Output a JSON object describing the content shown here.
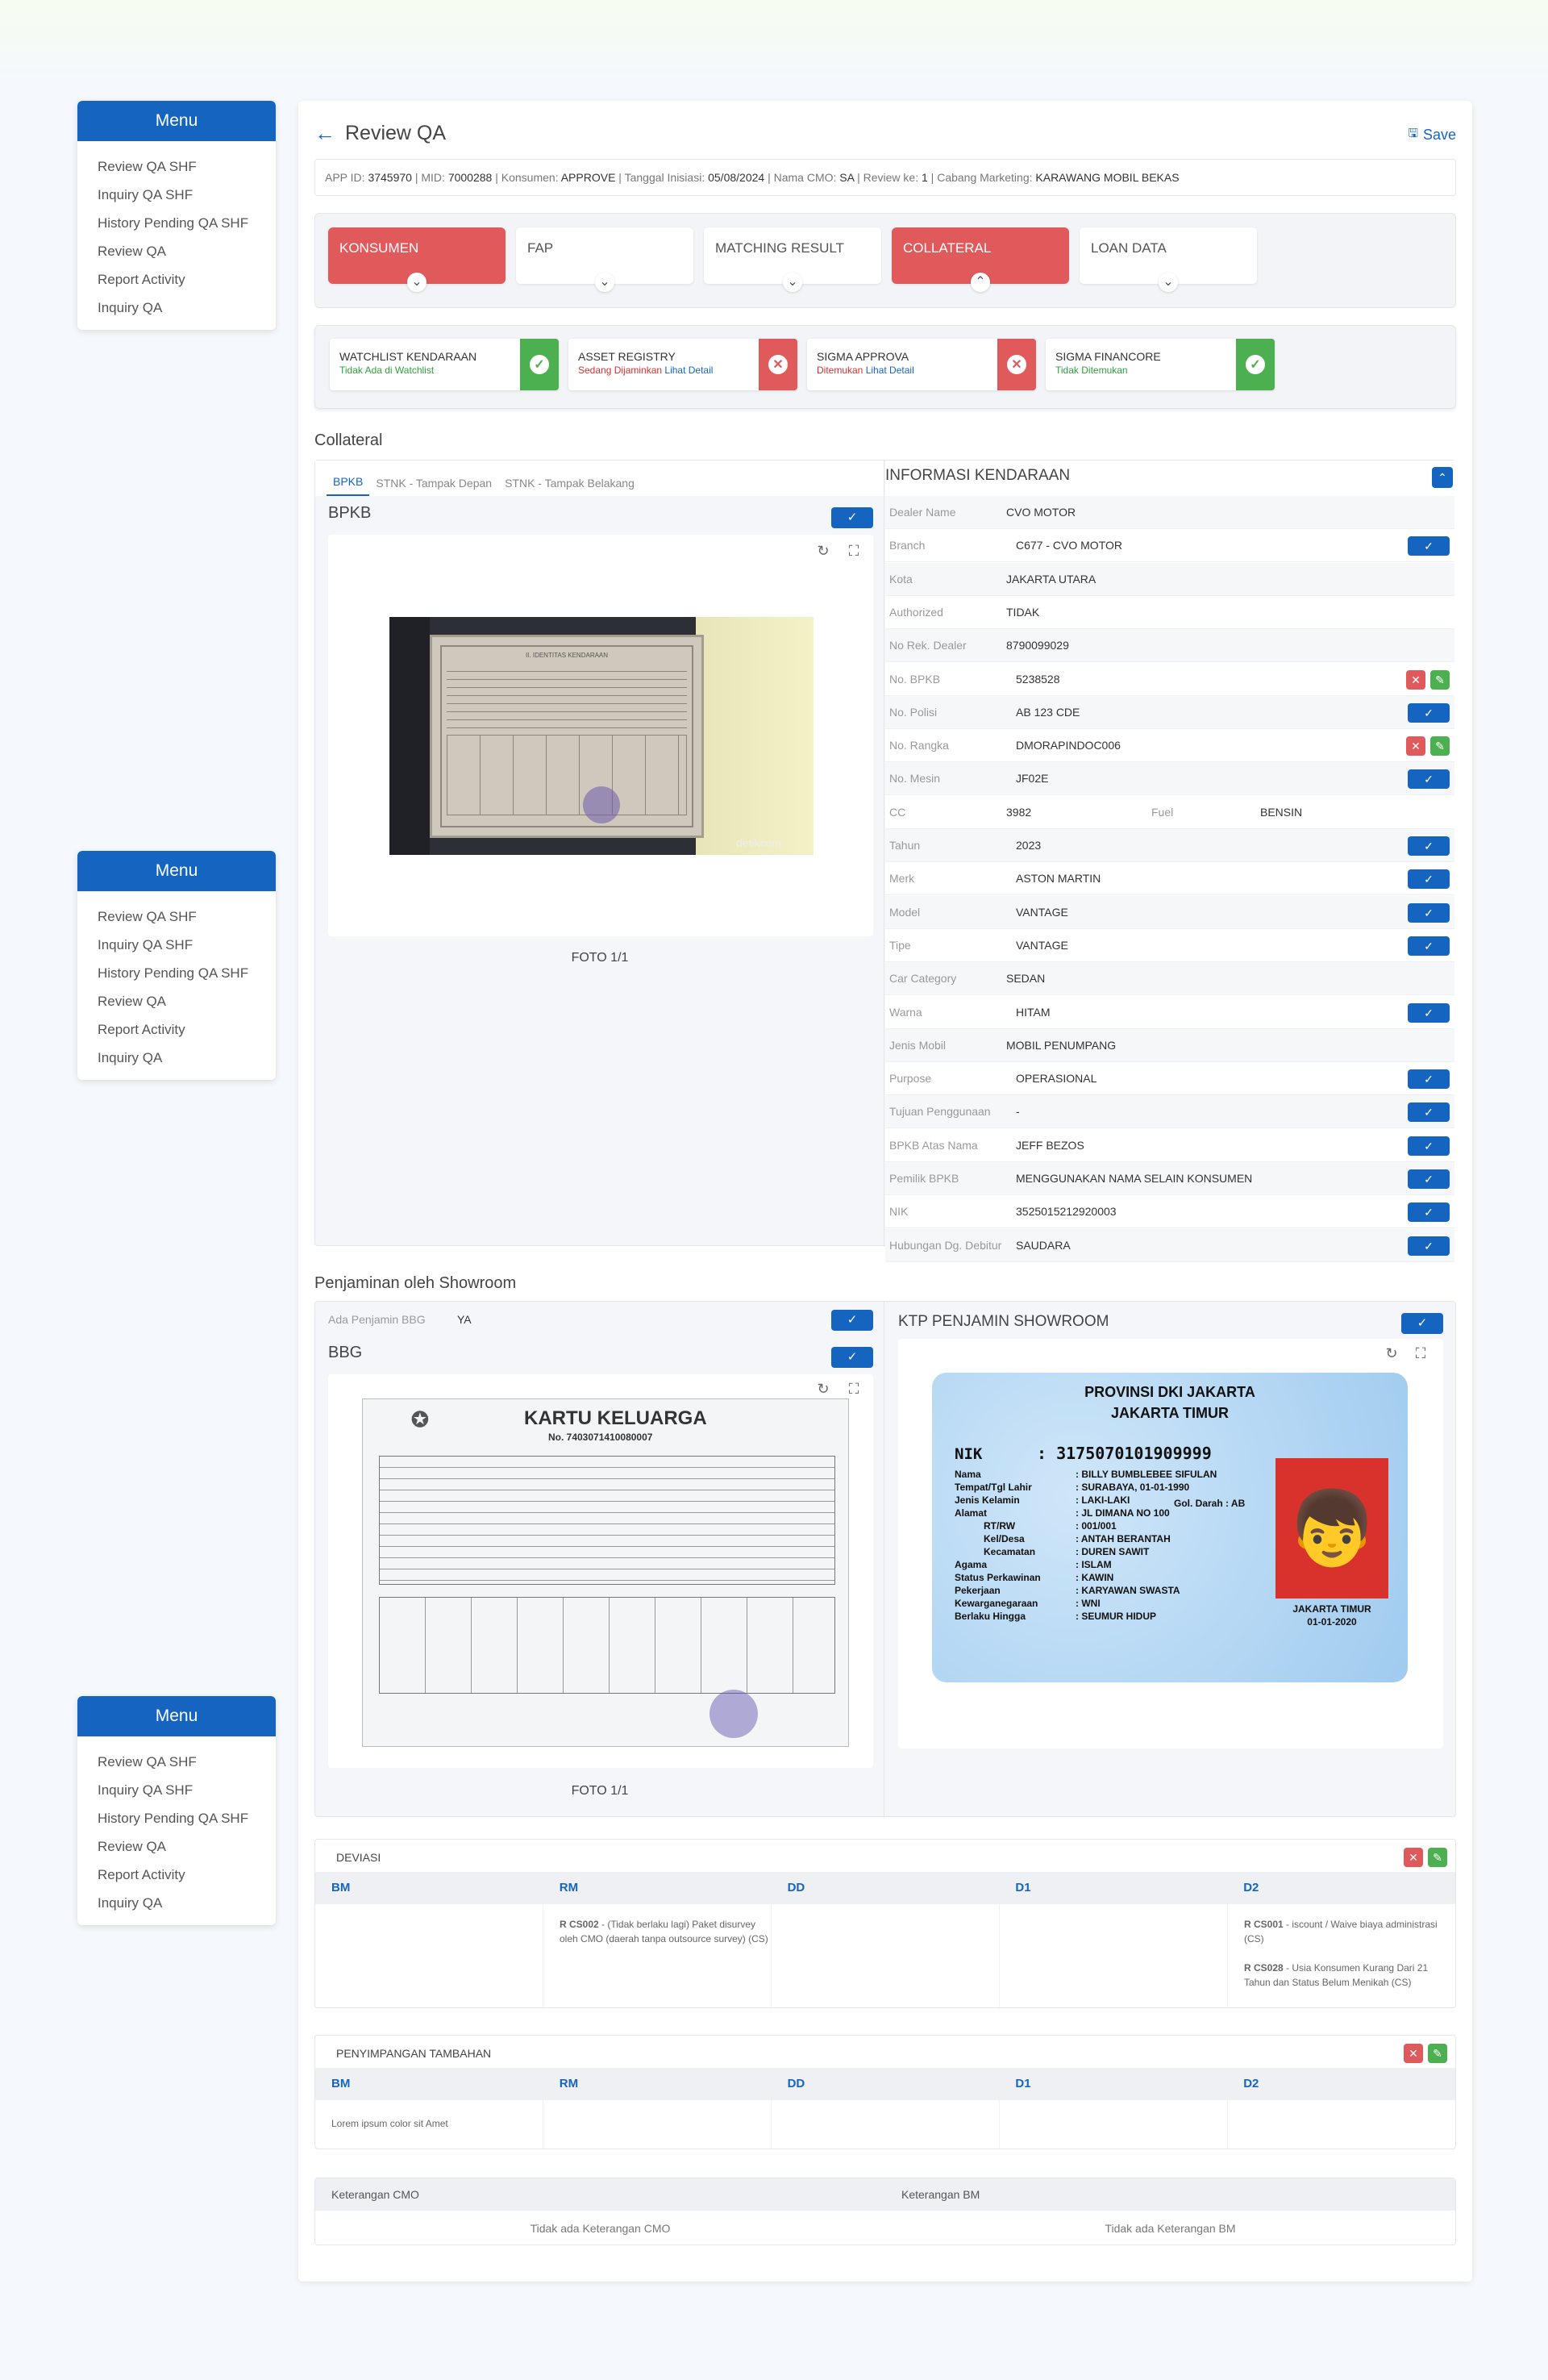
{
  "menu": {
    "title": "Menu",
    "items": [
      "Review QA SHF",
      "Inquiry QA SHF",
      "History Pending QA SHF",
      "Review QA",
      "Report Activity",
      "Inquiry QA"
    ]
  },
  "header": {
    "title": "Review QA",
    "save_label": "Save"
  },
  "info": {
    "app_id_label": "APP ID:",
    "app_id": "3745970",
    "mid_label": "MID:",
    "mid": "7000288",
    "konsumen_label": "Konsumen:",
    "konsumen": "APPROVE",
    "tgl_label": "Tanggal Inisiasi:",
    "tgl": "05/08/2024",
    "cmo_label": "Nama CMO:",
    "cmo": "SA",
    "review_label": "Review ke:",
    "review": "1",
    "cabang_label": "Cabang Marketing:",
    "cabang": "KARAWANG MOBIL BEKAS"
  },
  "tabs": [
    {
      "label": "KONSUMEN",
      "active": true
    },
    {
      "label": "FAP",
      "active": false
    },
    {
      "label": "MATCHING RESULT",
      "active": false
    },
    {
      "label": "COLLATERAL",
      "active": true
    },
    {
      "label": "LOAN DATA",
      "active": false
    }
  ],
  "checks": [
    {
      "title": "WATCHLIST KENDARAAN",
      "status": "Tidak Ada di Watchlist",
      "status_color": "#2e9e3e",
      "link": "",
      "ok": true
    },
    {
      "title": "ASSET REGISTRY",
      "status": "Sedang Dijaminkan",
      "status_color": "#d32f2f",
      "link": "Lihat Detail",
      "ok": false
    },
    {
      "title": "SIGMA APPROVA",
      "status": "Ditemukan",
      "status_color": "#d32f2f",
      "link": "Lihat Detail",
      "ok": false
    },
    {
      "title": "SIGMA FINANCORE",
      "status": "Tidak Ditemukan",
      "status_color": "#2e9e3e",
      "link": "",
      "ok": true
    }
  ],
  "collateral": {
    "title": "Collateral",
    "doc_tabs": [
      "BPKB",
      "STNK - Tampak Depan",
      "STNK - Tampak Belakang"
    ],
    "doc_title": "BPKB",
    "photo_caption": "FOTO 1/1",
    "bpkb_doc": {
      "heading": "II. IDENTITAS KENDARAAN",
      "watermark": "detikcom"
    },
    "info_title": "INFORMASI KENDARAAN",
    "fields": [
      {
        "k": "Dealer Name",
        "v": "CVO MOTOR",
        "btn": ""
      },
      {
        "k": "Branch",
        "v": "C677 - CVO MOTOR",
        "btn": "check"
      },
      {
        "k": "Kota",
        "v": "JAKARTA UTARA",
        "btn": ""
      },
      {
        "k": "Authorized",
        "v": "TIDAK",
        "btn": ""
      },
      {
        "k": "No Rek. Dealer",
        "v": "8790099029",
        "btn": ""
      },
      {
        "k": "No. BPKB",
        "v": "5238528",
        "btn": "xe"
      },
      {
        "k": "No. Polisi",
        "v": "AB 123 CDE",
        "btn": "check"
      },
      {
        "k": "No. Rangka",
        "v": "DMORAPINDOC006",
        "btn": "xe"
      },
      {
        "k": "No. Mesin",
        "v": "JF02E",
        "btn": "check"
      },
      {
        "k": "CC",
        "v": "3982",
        "btn": "",
        "k2": "Fuel",
        "v2": "BENSIN"
      },
      {
        "k": "Tahun",
        "v": "2023",
        "btn": "check"
      },
      {
        "k": "Merk",
        "v": "ASTON MARTIN",
        "btn": "check"
      },
      {
        "k": "Model",
        "v": "VANTAGE",
        "btn": "check"
      },
      {
        "k": "Tipe",
        "v": "VANTAGE",
        "btn": "check"
      },
      {
        "k": "Car Category",
        "v": "SEDAN",
        "btn": ""
      },
      {
        "k": "Warna",
        "v": "HITAM",
        "btn": "check"
      },
      {
        "k": "Jenis Mobil",
        "v": "MOBIL PENUMPANG",
        "btn": ""
      },
      {
        "k": "Purpose",
        "v": "OPERASIONAL",
        "btn": "check"
      },
      {
        "k": "Tujuan Penggunaan",
        "v": "-",
        "btn": "check"
      },
      {
        "k": "BPKB Atas Nama",
        "v": "JEFF BEZOS",
        "btn": "check"
      },
      {
        "k": "Pemilik BPKB",
        "v": "MENGGUNAKAN NAMA SELAIN KONSUMEN",
        "btn": "check"
      },
      {
        "k": "NIK",
        "v": "3525015212920003",
        "btn": "check"
      },
      {
        "k": "Hubungan Dg. Debitur",
        "v": "SAUDARA",
        "btn": "check"
      }
    ]
  },
  "penjaminan": {
    "title": "Penjaminan oleh Showroom",
    "ada_label": "Ada Penjamin BBG",
    "ada_value": "YA",
    "bbg_title": "BBG",
    "photo_caption": "FOTO 1/1",
    "kk": {
      "title": "KARTU KELUARGA",
      "number": "No. 7403071410080007"
    },
    "ktp_title": "KTP PENJAMIN SHOWROOM",
    "ktp": {
      "prov": "PROVINSI DKI JAKARTA",
      "city": "JAKARTA TIMUR",
      "nik_label": "NIK",
      "nik": ": 3175070101909999",
      "rows": [
        [
          "Nama",
          ": BILLY BUMBLEBEE SIFULAN"
        ],
        [
          "Tempat/Tgl Lahir",
          ": SURABAYA, 01-01-1990"
        ],
        [
          "Jenis Kelamin",
          ": LAKI-LAKI"
        ],
        [
          "Alamat",
          ": JL DIMANA NO 100"
        ],
        [
          "RT/RW",
          ": 001/001"
        ],
        [
          "Kel/Desa",
          ": ANTAH BERANTAH"
        ],
        [
          "Kecamatan",
          ": DUREN SAWIT"
        ],
        [
          "Agama",
          ": ISLAM"
        ],
        [
          "Status Perkawinan",
          ": KAWIN"
        ],
        [
          "Pekerjaan",
          ": KARYAWAN SWASTA"
        ],
        [
          "Kewarganegaraan",
          ": WNI"
        ],
        [
          "Berlaku Hingga",
          ": SEUMUR HIDUP"
        ]
      ],
      "goldarah": "Gol. Darah : AB",
      "sign_city": "JAKARTA TIMUR",
      "sign_date": "01-01-2020"
    }
  },
  "deviasi": {
    "title": "DEVIASI",
    "cols": [
      "BM",
      "RM",
      "DD",
      "D1",
      "D2"
    ],
    "rm": [
      {
        "code": "R CS002",
        "text": " - (Tidak berlaku lagi) Paket disurvey oleh CMO (daerah tanpa outsource survey) (CS)"
      }
    ],
    "d2": [
      {
        "code": "R CS001",
        "text": " - iscount / Waive biaya administrasi (CS)"
      },
      {
        "code": "R CS028",
        "text": " - Usia Konsumen Kurang Dari 21 Tahun dan Status Belum Menikah (CS)"
      }
    ]
  },
  "penyimpangan": {
    "title": "PENYIMPANGAN TAMBAHAN",
    "cols": [
      "BM",
      "RM",
      "DD",
      "D1",
      "D2"
    ],
    "bm": "Lorem ipsum color sit Amet"
  },
  "keterangan": {
    "cmo_label": "Keterangan CMO",
    "bm_label": "Keterangan BM",
    "cmo_value": "Tidak ada Keterangan CMO",
    "bm_value": "Tidak ada Keterangan BM"
  }
}
